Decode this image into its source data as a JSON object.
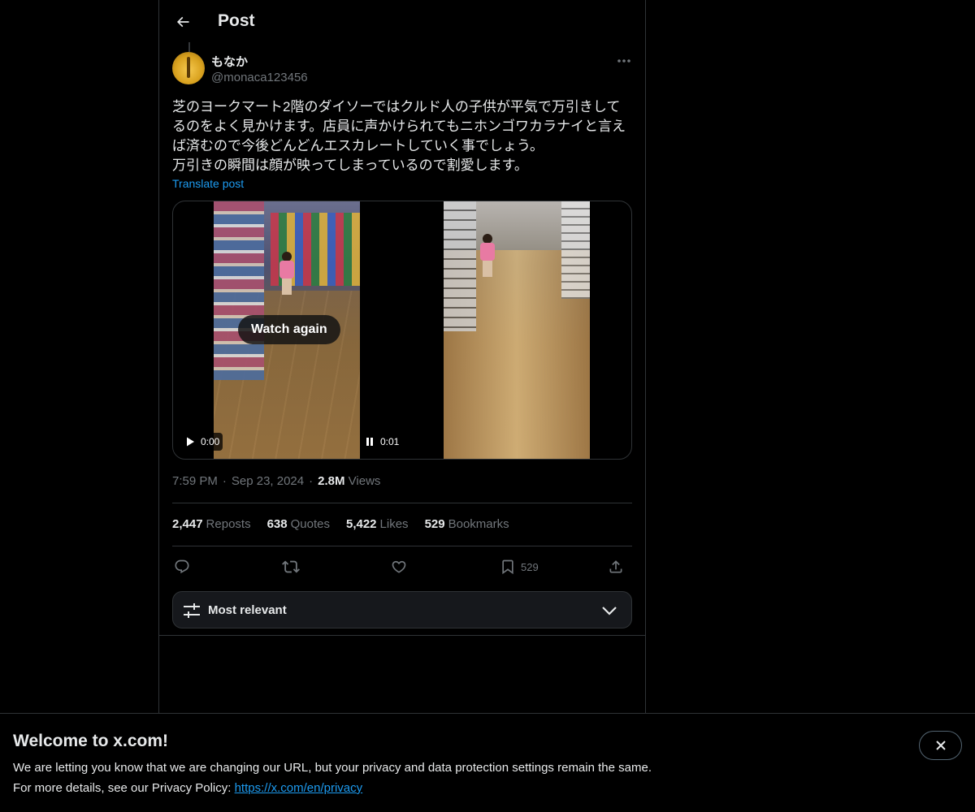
{
  "header": {
    "title": "Post"
  },
  "author": {
    "display_name": "もなか",
    "handle": "@monaca123456"
  },
  "post": {
    "text": "芝のヨークマート2階のダイソーではクルド人の子供が平気で万引きして\nるのをよく見かけます。店員に声かけられてもニホンゴワカラナイと言え\nば済むので今後どんどんエスカレートしていく事でしょう。\n万引きの瞬間は顔が映ってしまっているので割愛します。",
    "translate_label": "Translate post"
  },
  "media": {
    "watch_again_label": "Watch again",
    "left_time": "0:00",
    "right_time": "0:01"
  },
  "meta": {
    "time": "7:59 PM",
    "date": "Sep 23, 2024",
    "views_count": "2.8M",
    "views_label": "Views"
  },
  "stats": {
    "reposts_count": "2,447",
    "reposts_label": "Reposts",
    "quotes_count": "638",
    "quotes_label": "Quotes",
    "likes_count": "5,422",
    "likes_label": "Likes",
    "bookmarks_count": "529",
    "bookmarks_label": "Bookmarks"
  },
  "actions": {
    "bookmark_count": "529"
  },
  "sort": {
    "label": "Most relevant"
  },
  "banner": {
    "title": "Welcome to x.com!",
    "line1": "We are letting you know that we are changing our URL, but your privacy and data protection settings remain the same.",
    "line2_prefix": "For more details, see our Privacy Policy: ",
    "link": "https://x.com/en/privacy"
  },
  "colors": {
    "accent": "#1d9bf0",
    "background": "#000000",
    "muted_text": "#71767b",
    "border": "#2f3336"
  },
  "icons": [
    "back-arrow-icon",
    "more-icon",
    "play-icon",
    "pause-icon",
    "reply-icon",
    "repost-icon",
    "like-icon",
    "bookmark-icon",
    "share-icon",
    "sort-sliders-icon",
    "chevron-down-icon",
    "close-icon"
  ]
}
